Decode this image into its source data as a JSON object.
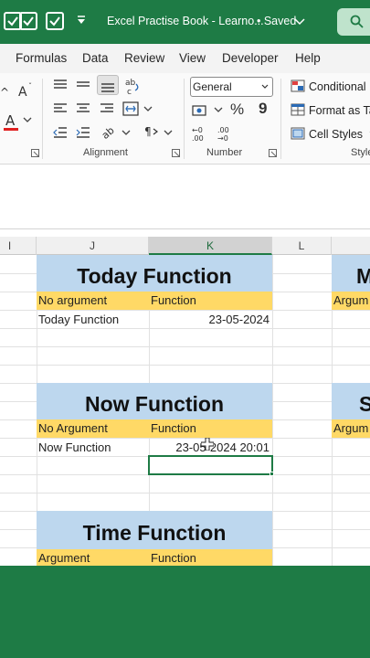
{
  "titlebar": {
    "doc_title": "Excel Practise Book - Learno...",
    "saved_label": "• Saved",
    "quick_access": [
      "checkbox-icon",
      "checkbox-icon",
      "checkbox-icon",
      "customize-arrow-icon"
    ]
  },
  "ribbon_tabs": [
    "Formulas",
    "Data",
    "Review",
    "View",
    "Developer",
    "Help"
  ],
  "ribbon": {
    "alignment_label": "Alignment",
    "number_label": "Number",
    "styles_label": "Style",
    "number_format_value": "General",
    "conditional_formatting": "Conditional F",
    "format_as_table": "Format as Ta",
    "cell_styles": "Cell Styles",
    "number_buttons": [
      "%",
      "9"
    ]
  },
  "columns": [
    "I",
    "J",
    "K",
    "L"
  ],
  "selected_column": "K",
  "sheet": {
    "today": {
      "title": "Today Function",
      "col1_header": "No argument",
      "col2_header": "Function",
      "row_label": "Today Function",
      "row_value": "23-05-2024"
    },
    "now": {
      "title": "Now Function",
      "col1_header": "No Argument",
      "col2_header": "Function",
      "row_label": "Now Function",
      "row_value": "23-05-2024 20:01"
    },
    "time": {
      "title": "Time Function",
      "col1_header": "Argument",
      "col2_header": "Function"
    },
    "right_partial": {
      "title_top": "M",
      "header_top": "Argum",
      "title_mid": "S",
      "header_mid": "Argum"
    }
  },
  "colors": {
    "excel_green": "#1e7b45",
    "title_fill": "#bdd7ee",
    "header_fill": "#ffd966"
  }
}
